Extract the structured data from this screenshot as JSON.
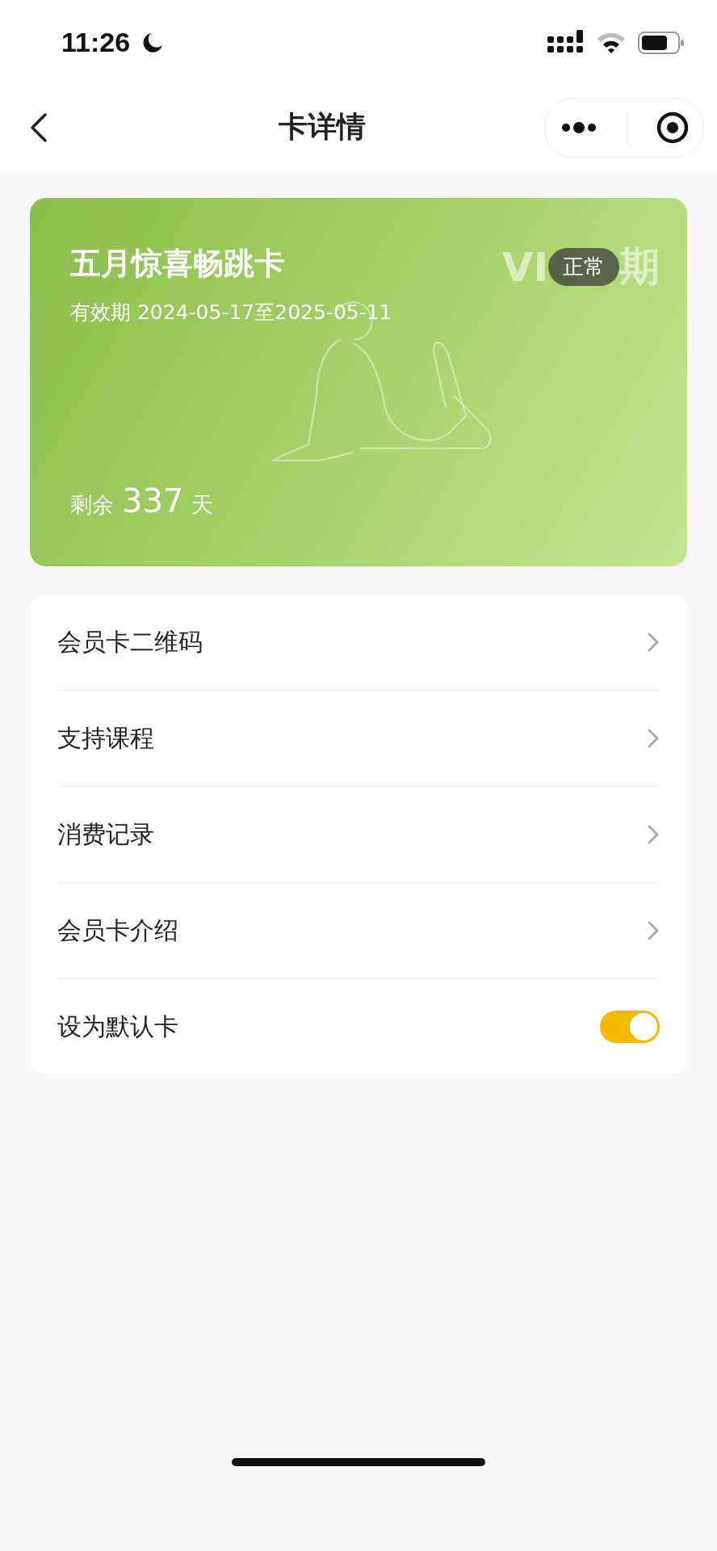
{
  "status_bar": {
    "time": "11:26"
  },
  "nav": {
    "title": "卡详情"
  },
  "card": {
    "name": "五月惊喜畅跳卡",
    "validity": "有效期 2024-05-17至2025-05-11",
    "mark_left": "VI",
    "mark_right": "期",
    "status": "正常",
    "remaining_label": "剩余",
    "remaining_days": "337",
    "remaining_unit": "天"
  },
  "menu": [
    {
      "kind": "link",
      "label": "会员卡二维码"
    },
    {
      "kind": "link",
      "label": "支持课程"
    },
    {
      "kind": "link",
      "label": "消费记录"
    },
    {
      "kind": "link",
      "label": "会员卡介绍"
    },
    {
      "kind": "toggle",
      "label": "设为默认卡",
      "on": true
    }
  ]
}
